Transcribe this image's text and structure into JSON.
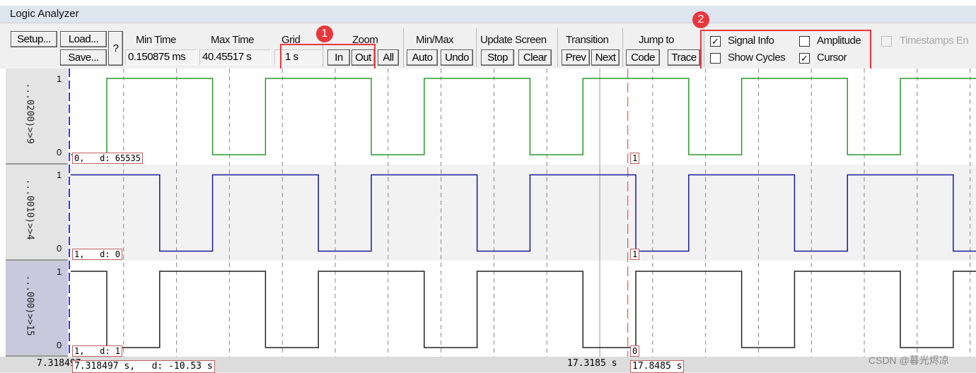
{
  "window": {
    "title": "Logic Analyzer"
  },
  "toolbar": {
    "setup": "Setup...",
    "load": "Load...",
    "save": "Save...",
    "help": "?",
    "min_time_label": "Min Time",
    "min_time": "0.150875 ms",
    "max_time_label": "Max Time",
    "max_time": "40.45517 s",
    "grid_label": "Grid",
    "grid": "1 s",
    "zoom_label": "Zoom",
    "zoom_in": "In",
    "zoom_out": "Out",
    "zoom_all": "All",
    "minmax_label": "Min/Max",
    "auto": "Auto",
    "undo": "Undo",
    "update_label": "Update Screen",
    "stop": "Stop",
    "clear": "Clear",
    "transition_label": "Transition",
    "prev": "Prev",
    "next": "Next",
    "jump_label": "Jump to",
    "code": "Code",
    "trace": "Trace",
    "signal_info": {
      "label": "Signal Info",
      "checked": true
    },
    "amplitude": {
      "label": "Amplitude",
      "checked": false
    },
    "show_cycles": {
      "label": "Show Cycles",
      "checked": false
    },
    "cursor": {
      "label": "Cursor",
      "checked": true
    },
    "timestamps": {
      "label": "Timestamps En",
      "checked": false,
      "disabled": true
    }
  },
  "annotations": {
    "badge1": "1",
    "badge2": "2"
  },
  "signals": [
    {
      "name": "...0200)>>9",
      "color": "#2a9a2a",
      "high": "1",
      "low": "0",
      "initial": 0,
      "transitions": [
        8,
        10,
        11,
        13,
        14,
        16,
        17,
        19,
        20,
        22,
        23
      ],
      "info": "0,   d: 65535",
      "cursor_value": "1"
    },
    {
      "name": "...0010)>>4",
      "color": "#1a1a9a",
      "high": "1",
      "low": "0",
      "initial": 1,
      "transitions": [
        9,
        10,
        12,
        13,
        15,
        16,
        18,
        19,
        21,
        22,
        24
      ],
      "info": "1,   d: 0",
      "cursor_value": "1"
    },
    {
      "name": "...000)>>15",
      "color": "#222222",
      "high": "1",
      "low": "0",
      "initial": 1,
      "transitions": [
        8,
        9,
        11,
        12,
        14,
        15,
        17,
        18,
        20,
        21,
        23,
        24
      ],
      "info": "1,   d: 1",
      "cursor_value": "0"
    }
  ],
  "timeline": {
    "start": 7.318497,
    "end": 24.43,
    "grid_s": 1,
    "start_label": "7.318497",
    "start_info": "7.318497 s,   d: -10.53 s",
    "cursor_time": 17.3185,
    "cursor_label": "17.3185 s",
    "marker_time": 17.8485,
    "marker_label": "17.8485 s"
  },
  "watermark": "CSDN @暮光烬凉"
}
